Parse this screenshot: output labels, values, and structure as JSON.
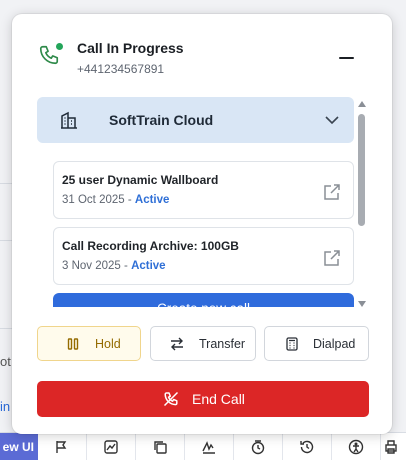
{
  "background": {
    "partial_text_1": "ot",
    "partial_link_1": "in",
    "new_ui_label": "ew UI",
    "toolbar_icons": [
      "flag-icon",
      "chart-icon",
      "copy-icon",
      "signature-icon",
      "clock-icon",
      "history-icon",
      "accessibility-icon",
      "printer-icon"
    ]
  },
  "call": {
    "title": "Call In Progress",
    "number": "+441234567891",
    "status_color": "#23a55a",
    "accent_color": "#2f8a4a"
  },
  "account": {
    "name": "SoftTrain Cloud",
    "cards": [
      {
        "title": "25 user Dynamic Wallboard",
        "date": "31 Oct 2025",
        "separator": " - ",
        "status": "Active"
      },
      {
        "title": "Call Recording Archive: 100GB",
        "date": "3 Nov 2025",
        "separator": " - ",
        "status": "Active"
      }
    ],
    "create_label": "Create new call"
  },
  "actions": {
    "hold_label": "Hold",
    "transfer_label": "Transfer",
    "dialpad_label": "Dialpad",
    "end_call_label": "End Call"
  },
  "colors": {
    "primary": "#2f6bdc",
    "danger": "#dc2626",
    "hold_bg": "#fffbec",
    "hold_text": "#946b00",
    "account_bg": "#d9e6f5",
    "status_active": "#2f6fd6"
  }
}
